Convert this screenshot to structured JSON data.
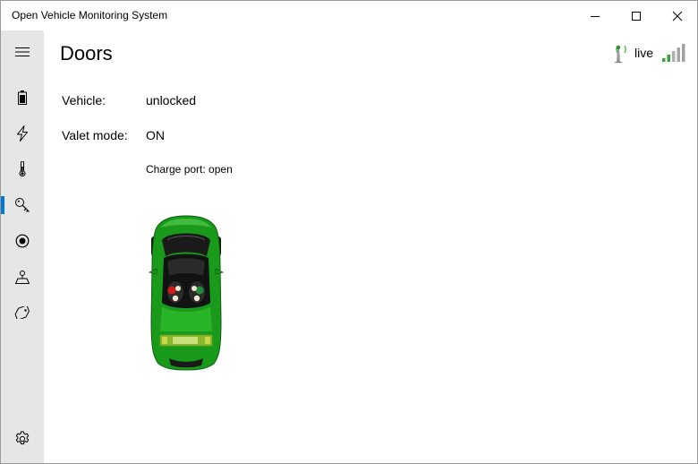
{
  "window": {
    "title": "Open Vehicle Monitoring System",
    "controls": [
      "minimize",
      "maximize",
      "close"
    ]
  },
  "nav": {
    "items": [
      {
        "name": "menu",
        "icon": "hamburger-icon"
      },
      {
        "name": "battery",
        "icon": "battery-icon"
      },
      {
        "name": "charging",
        "icon": "lightning-icon"
      },
      {
        "name": "temperature",
        "icon": "thermometer-icon"
      },
      {
        "name": "doors",
        "icon": "key-icon",
        "selected": true
      },
      {
        "name": "tpms",
        "icon": "tire-icon"
      },
      {
        "name": "location",
        "icon": "location-pin-icon"
      },
      {
        "name": "tags",
        "icon": "tag-icon"
      }
    ],
    "settings_icon": "gear-icon",
    "accent_color": "#0078d7"
  },
  "header": {
    "title": "Doors",
    "status_text": "live",
    "signal_bars_active": 2,
    "signal_bars_total": 5
  },
  "doors": {
    "vehicle_label": "Vehicle:",
    "vehicle_value": "unlocked",
    "valet_label": "Valet mode:",
    "valet_value": "ON",
    "charge_port_label": "Charge port:",
    "charge_port_value": "open"
  },
  "colors": {
    "car_body": "#1a9a1a",
    "nav_bg": "#e6e6e6",
    "signal_active": "#3aa63a",
    "signal_inactive": "#a0a0a0"
  }
}
